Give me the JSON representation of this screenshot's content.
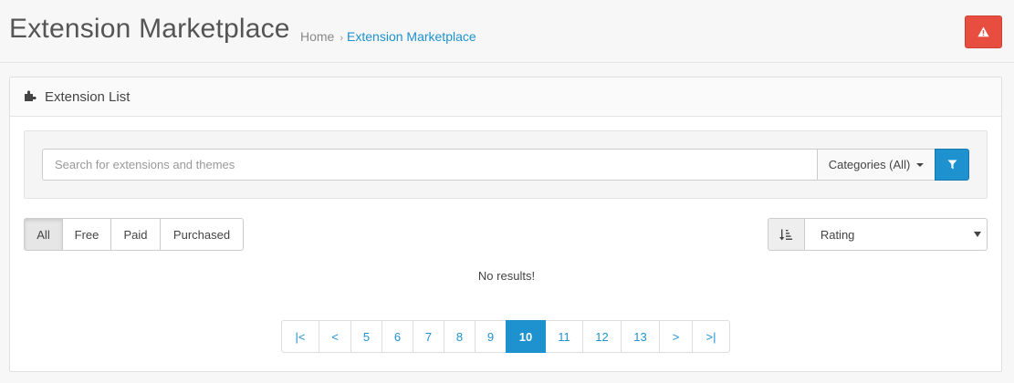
{
  "header": {
    "title": "Extension Marketplace",
    "breadcrumb": [
      {
        "label": "Home"
      },
      {
        "label": "Extension Marketplace"
      }
    ],
    "alert_icon": "warning-icon",
    "alert_color": "#e84e40"
  },
  "panel": {
    "title": "Extension List",
    "icon": "puzzle-icon"
  },
  "search": {
    "placeholder": "Search for extensions and themes",
    "value": "",
    "categories_label": "Categories (All)",
    "filter_icon": "filter-icon"
  },
  "filters": [
    {
      "label": "All",
      "active": true
    },
    {
      "label": "Free",
      "active": false
    },
    {
      "label": "Paid",
      "active": false
    },
    {
      "label": "Purchased",
      "active": false
    }
  ],
  "sort": {
    "icon": "sort-amount-icon",
    "selected": "Rating"
  },
  "results": {
    "message": "No results!"
  },
  "pagination": {
    "pages": [
      "|<",
      "<",
      "5",
      "6",
      "7",
      "8",
      "9",
      "10",
      "11",
      "12",
      "13",
      ">",
      ">|"
    ],
    "current": "10"
  },
  "colors": {
    "accent": "#1e91cf",
    "danger": "#e84e40"
  }
}
